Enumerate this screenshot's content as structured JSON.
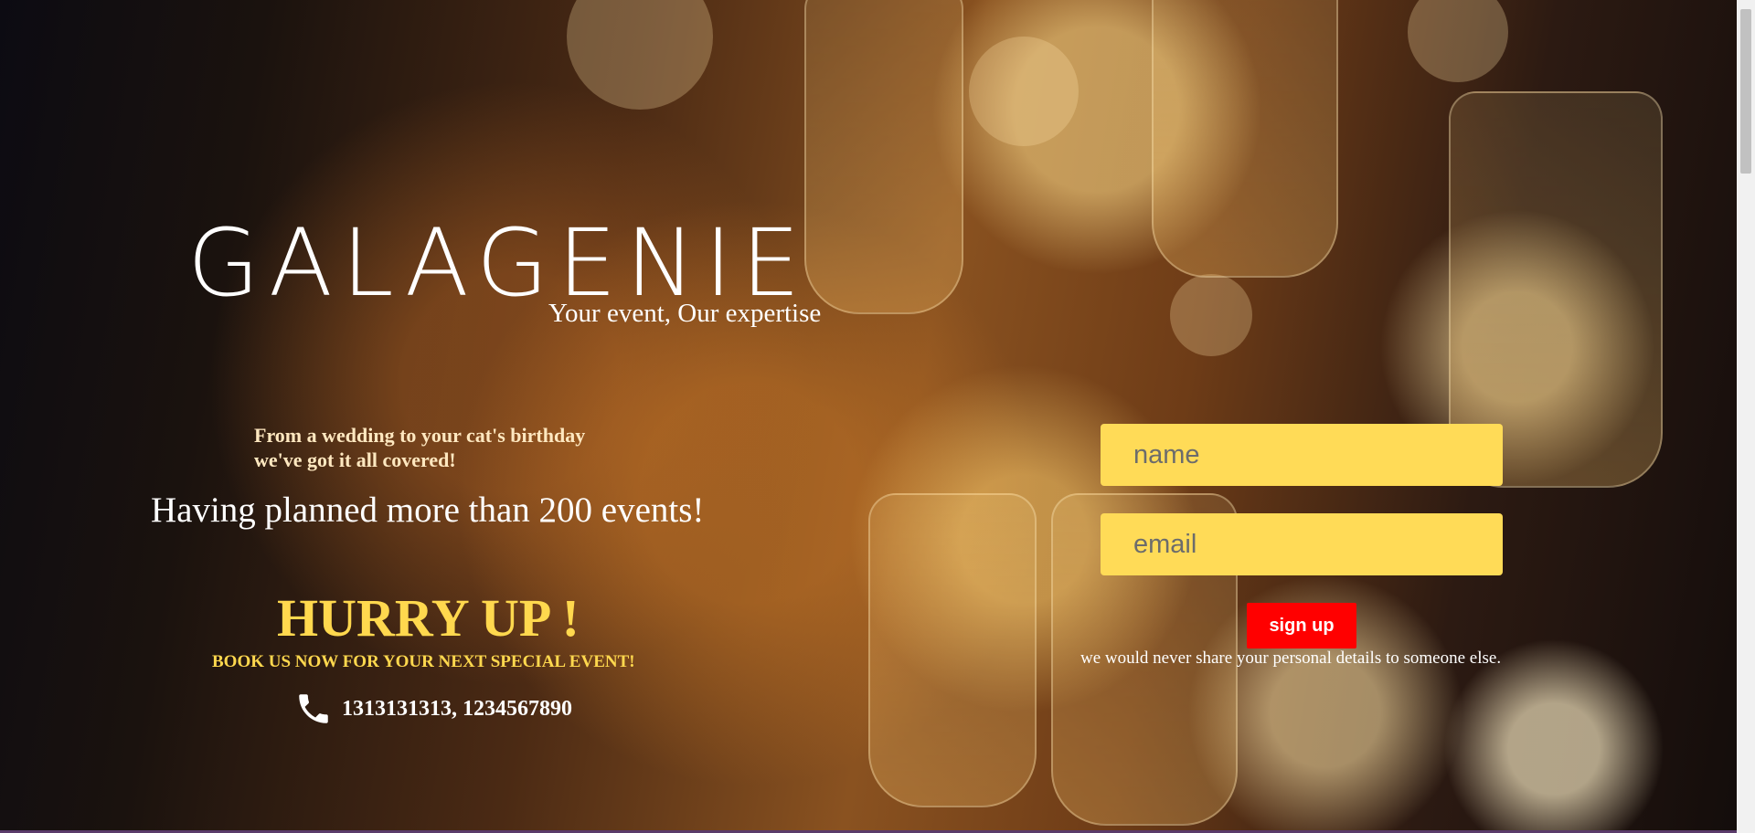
{
  "brand": {
    "logo_text": "GALAGENIE",
    "tagline": "Your event, Our expertise"
  },
  "hero": {
    "covered_line1": "From a wedding to your cat's birthday",
    "covered_line2": "we've got it all covered!",
    "planned": "Having planned more than 200 events!",
    "hurry": "HURRY UP !",
    "book": "BOOK US NOW FOR YOUR NEXT SPECIAL EVENT!",
    "phone_icon": "phone-icon",
    "phones": "1313131313, 1234567890"
  },
  "form": {
    "name_placeholder": "name",
    "email_placeholder": "email",
    "signup_label": "sign up",
    "privacy": "we would never share your personal details to someone else."
  },
  "colors": {
    "accent_yellow": "#ffd84e",
    "input_yellow": "#ffdb57",
    "button_red": "#ff0000"
  }
}
